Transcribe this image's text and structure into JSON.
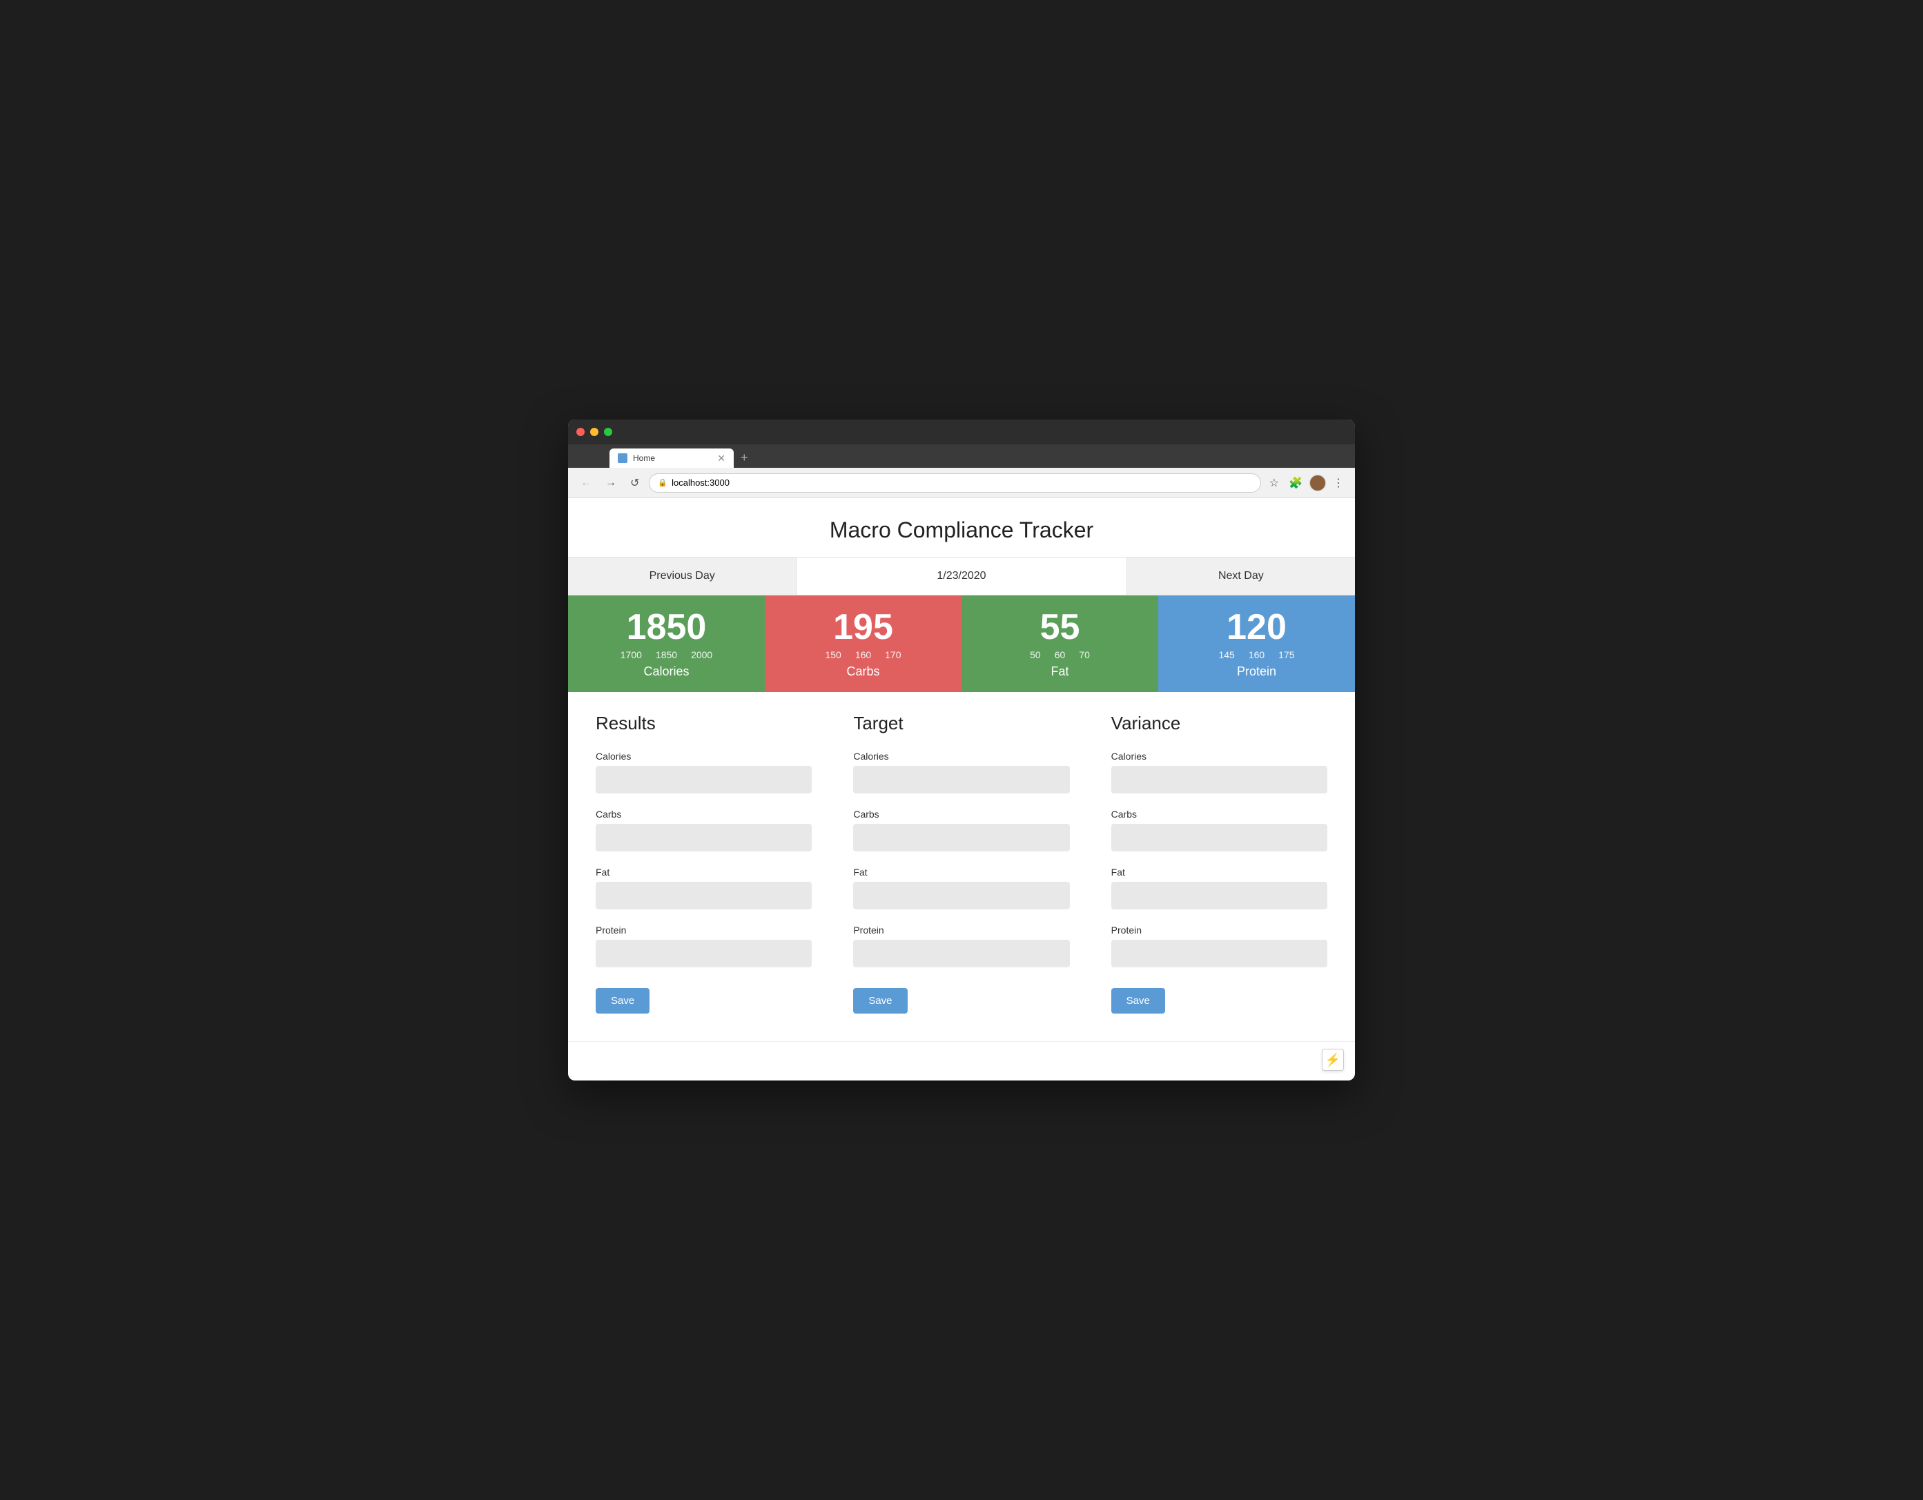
{
  "browser": {
    "tab_label": "Home",
    "address": "localhost:3000",
    "nav_back": "←",
    "nav_forward": "→",
    "nav_refresh": "↺"
  },
  "app": {
    "title": "Macro Compliance Tracker"
  },
  "day_nav": {
    "previous": "Previous Day",
    "current": "1/23/2020",
    "next": "Next Day"
  },
  "macros": {
    "calories": {
      "value": "1850",
      "min": "1700",
      "mid": "1850",
      "max": "2000",
      "label": "Calories"
    },
    "carbs": {
      "value": "195",
      "min": "150",
      "mid": "160",
      "max": "170",
      "label": "Carbs"
    },
    "fat": {
      "value": "55",
      "min": "50",
      "mid": "60",
      "max": "70",
      "label": "Fat"
    },
    "protein": {
      "value": "120",
      "min": "145",
      "mid": "160",
      "max": "175",
      "label": "Protein"
    }
  },
  "columns": {
    "results": {
      "heading": "Results",
      "labels": {
        "calories": "Calories",
        "carbs": "Carbs",
        "fat": "Fat",
        "protein": "Protein"
      },
      "save_label": "Save"
    },
    "target": {
      "heading": "Target",
      "labels": {
        "calories": "Calories",
        "carbs": "Carbs",
        "fat": "Fat",
        "protein": "Protein"
      },
      "save_label": "Save"
    },
    "variance": {
      "heading": "Variance",
      "labels": {
        "calories": "Calories",
        "carbs": "Carbs",
        "fat": "Fat",
        "protein": "Protein"
      },
      "save_label": "Save"
    }
  }
}
